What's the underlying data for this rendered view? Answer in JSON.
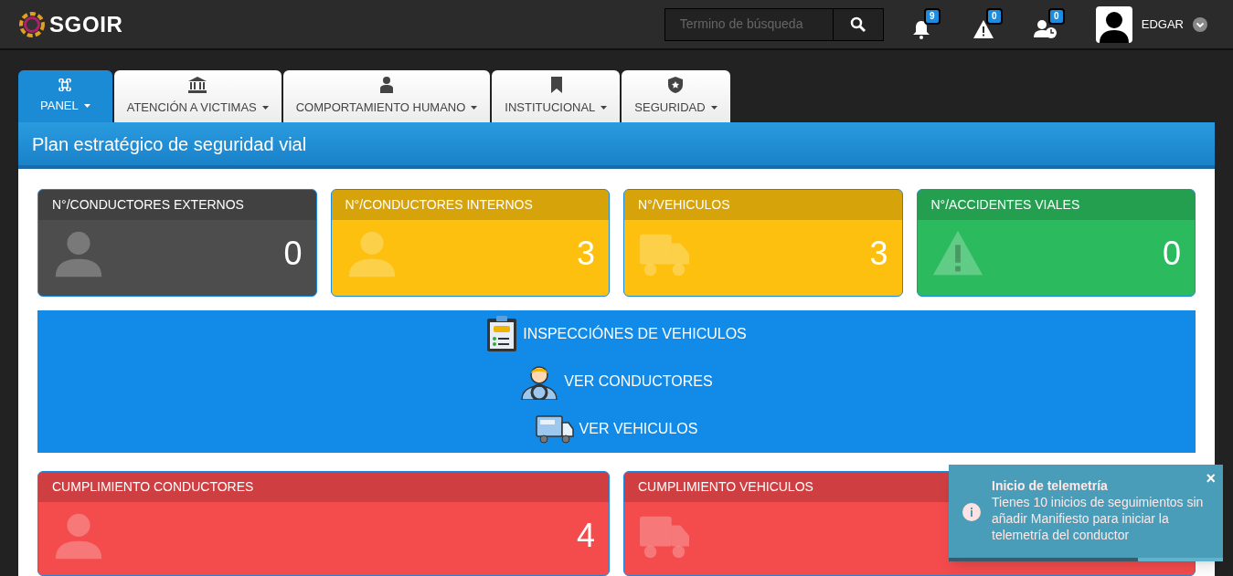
{
  "brand": "SGOIR",
  "search": {
    "placeholder": "Termino de búsqueda"
  },
  "header_icons": [
    {
      "kind": "bell",
      "count": "9"
    },
    {
      "kind": "warning",
      "count": "0"
    },
    {
      "kind": "user-clock",
      "count": "0"
    }
  ],
  "user": {
    "name": "EDGAR"
  },
  "tabs": [
    {
      "kind": "command",
      "label": "PANEL",
      "selected": true
    },
    {
      "kind": "bank",
      "label": "ATENCIÓN A VICTIMAS",
      "selected": false
    },
    {
      "kind": "person",
      "label": "COMPORTAMIENTO HUMANO",
      "selected": false
    },
    {
      "kind": "bookmark",
      "label": "INSTITUCIONAL",
      "selected": false
    },
    {
      "kind": "shield",
      "label": "SEGURIDAD",
      "selected": false
    }
  ],
  "panel_title": "Plan estratégico de seguridad vial",
  "stat_cards": [
    {
      "title": "N°/CONDUCTORES EXTERNOS",
      "value": "0",
      "kind": "user",
      "color": "#4d4d4d"
    },
    {
      "title": "N°/CONDUCTORES INTERNOS",
      "value": "3",
      "kind": "user",
      "color": "#fdc00e"
    },
    {
      "title": "N°/VEHICULOS",
      "value": "3",
      "kind": "truck",
      "color": "#fdc00e"
    },
    {
      "title": "N°/ACCIDENTES VIALES",
      "value": "0",
      "kind": "warning",
      "color": "#2bbb5e"
    }
  ],
  "links": [
    {
      "kind": "clipboard",
      "label": "INSPECCIÓNES DE VEHICULOS"
    },
    {
      "kind": "driver",
      "label": "VER CONDUCTORES"
    },
    {
      "kind": "truck",
      "label": "VER VEHICULOS"
    }
  ],
  "compliance_cards": [
    {
      "title": "CUMPLIMIENTO CONDUCTORES",
      "value": "4",
      "kind": "user",
      "color": "#f44b4d"
    },
    {
      "title": "CUMPLIMIENTO VEHICULOS",
      "kind": "truck",
      "color": "#f44b4d"
    }
  ],
  "toast": {
    "title": "Inicio de telemetría",
    "message": "Tienes 10 inicios de seguimientos sin añadir Manifiesto para iniciar la telemetría del conductor",
    "close": "×",
    "level": 0.69
  }
}
